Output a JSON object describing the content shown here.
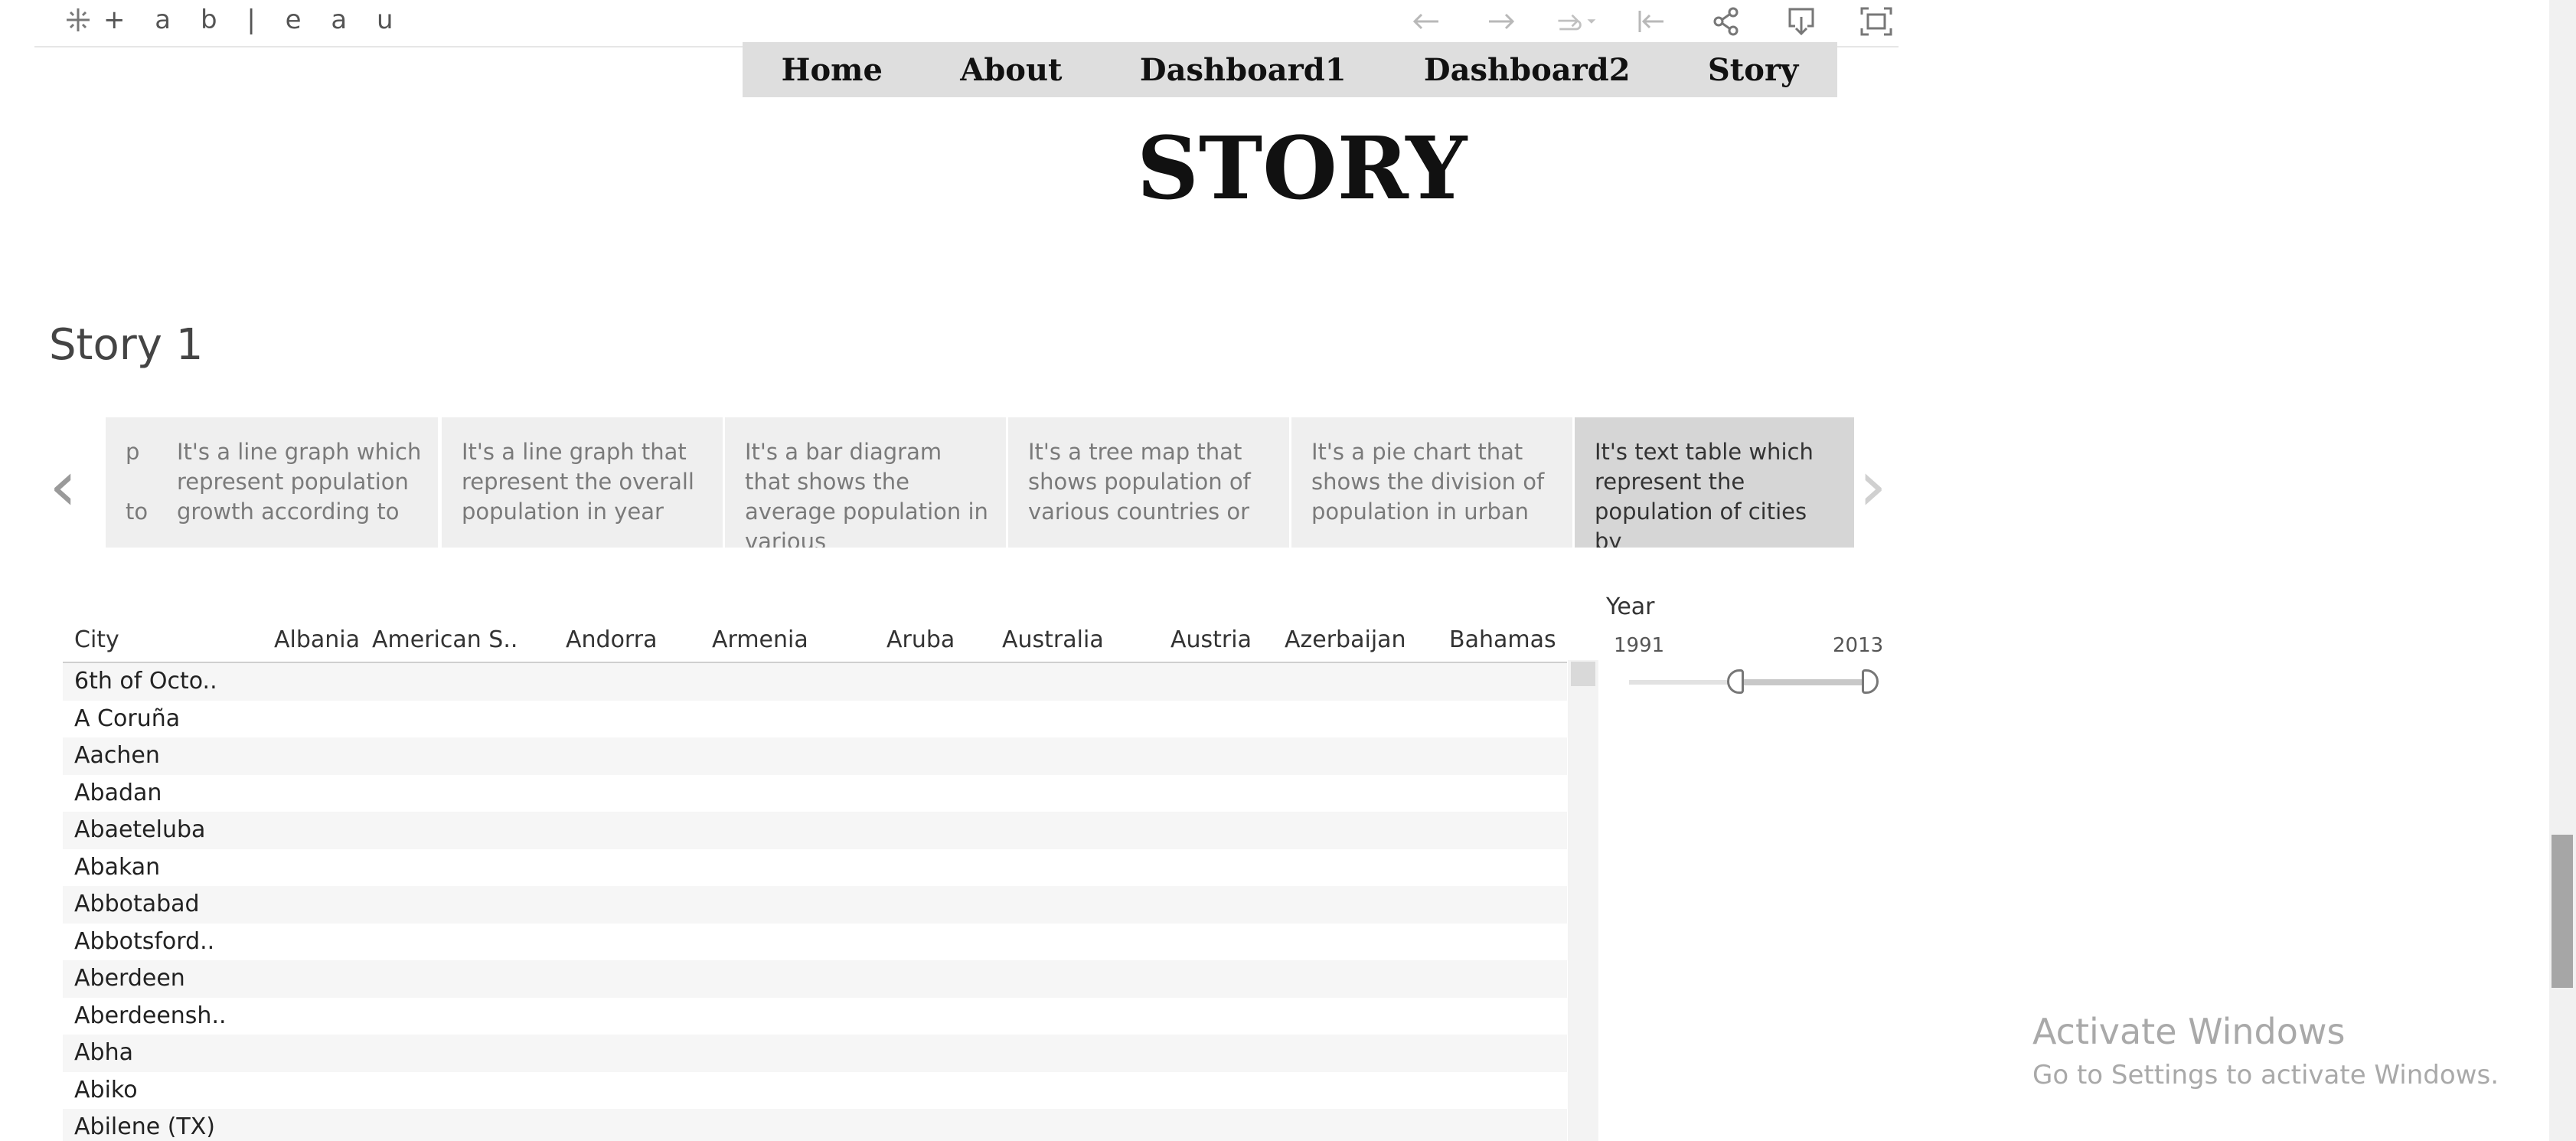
{
  "toolbar": {
    "logo_text": "+ a b | e a u",
    "icons": [
      "undo-icon",
      "redo-icon",
      "revert-icon",
      "revert-dropdown-icon",
      "reset-icon",
      "share-icon",
      "download-icon",
      "fullscreen-icon"
    ]
  },
  "nav": {
    "items": [
      "Home",
      "About",
      "Dashboard1",
      "Dashboard2",
      "Story"
    ]
  },
  "page_title": "STORY",
  "story_title": "Story 1",
  "story_points": [
    {
      "text": "p\n\nto"
    },
    {
      "text": "It's a line graph which represent population growth according to"
    },
    {
      "text": "It's a line graph that represent the overall population  in year"
    },
    {
      "text": "It's a bar diagram that shows the average population in various"
    },
    {
      "text": "It's a tree map that shows population of various countries or"
    },
    {
      "text": "It's a pie chart that shows the division of population in urban"
    },
    {
      "text": "It's text table which represent the population of cities by",
      "active": true
    }
  ],
  "table": {
    "row_header": "City",
    "columns": [
      "Albania",
      "American S..",
      "Andorra",
      "Armenia",
      "Aruba",
      "Australia",
      "Austria",
      "Azerbaijan",
      "Bahamas"
    ],
    "rows": [
      "6th of Octo..",
      "A Coruña",
      "Aachen",
      "Abadan",
      "Abaeteluba",
      "Abakan",
      "Abbotabad",
      "Abbotsford..",
      "Aberdeen",
      "Aberdeensh..",
      "Abha",
      "Abiko",
      "Abilene (TX)"
    ]
  },
  "filter": {
    "label": "Year",
    "min": "1991",
    "max": "2013"
  },
  "watermark": {
    "title": "Activate Windows",
    "subtitle": "Go to Settings to activate Windows."
  }
}
